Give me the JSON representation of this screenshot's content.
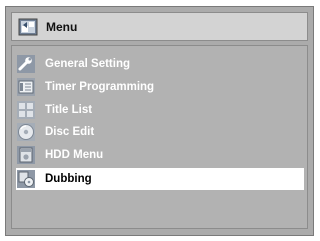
{
  "menu": {
    "title": "Menu",
    "icon": "menu-icon",
    "items": [
      {
        "label": "General Setting",
        "icon": "wrench-icon",
        "selected": false
      },
      {
        "label": "Timer Programming",
        "icon": "timer-icon",
        "selected": false
      },
      {
        "label": "Title List",
        "icon": "title-list-icon",
        "selected": false
      },
      {
        "label": "Disc Edit",
        "icon": "disc-icon",
        "selected": false
      },
      {
        "label": "HDD Menu",
        "icon": "hdd-icon",
        "selected": false
      },
      {
        "label": "Dubbing",
        "icon": "dubbing-icon",
        "selected": true
      }
    ]
  },
  "colors": {
    "panel_background": "#ababab",
    "title_bar": "#d3d3d3",
    "selected_row": "#ffffff",
    "label_text": "#ffffff",
    "selected_text": "#000000"
  }
}
